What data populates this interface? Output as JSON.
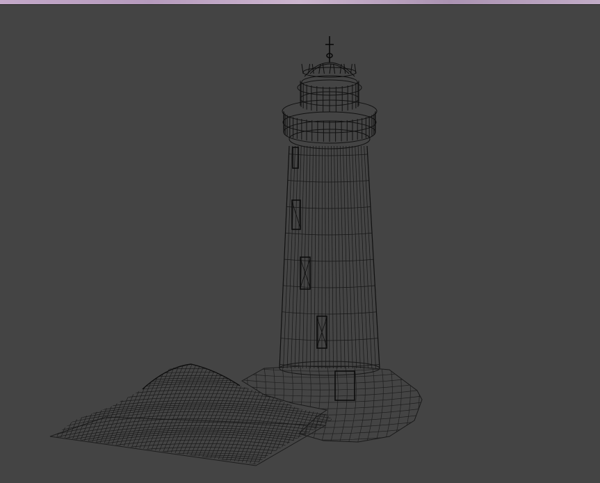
{
  "viewport": {
    "background": "#444444",
    "wire_color": "#141414",
    "frame_accent": "#c4a9c9",
    "render_mode": "wireframe"
  },
  "scene": {
    "objects": [
      "lighthouse",
      "rock-base",
      "terrain-mesh"
    ]
  }
}
